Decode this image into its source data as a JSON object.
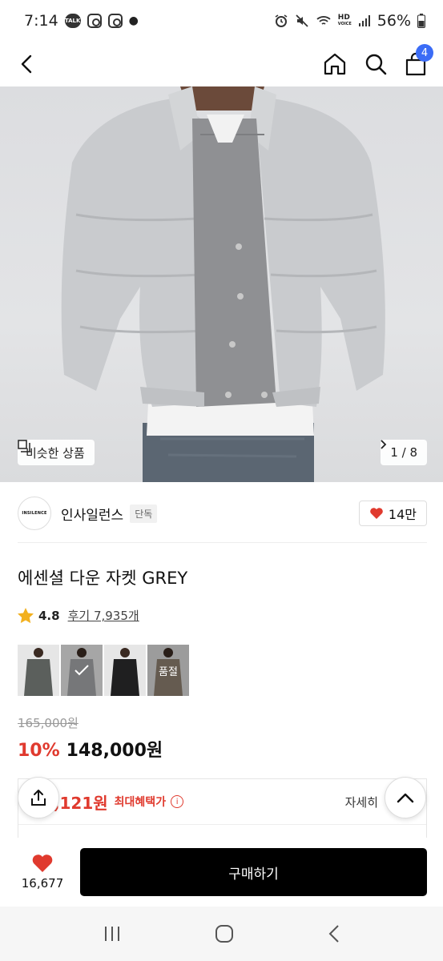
{
  "status": {
    "time": "7:14",
    "talk": "TALK",
    "hd": "HD",
    "voice": "VOICE",
    "battery": "56%"
  },
  "appbar": {
    "cart_count": "4"
  },
  "hero": {
    "similar_label": "비슷한 상품",
    "counter": "1 / 8"
  },
  "brand": {
    "logo_text": "INSILENCE",
    "name": "인사일런스",
    "tag": "단독",
    "likes": "14만"
  },
  "product": {
    "title": "에센셜 다운 자켓 GREY",
    "rating": "4.8",
    "reviews": "후기 7,935개",
    "variants": [
      {
        "color": "#5b5f5c",
        "soldout": ""
      },
      {
        "color": "#a4a6a8",
        "soldout": "",
        "selected": true
      },
      {
        "color": "#1f1f20",
        "soldout": ""
      },
      {
        "color": "#8c7f6f",
        "soldout": "품절"
      }
    ],
    "original_price": "165,000원",
    "discount": "10%",
    "price": "148,000원"
  },
  "benefit": {
    "price": "2,121원",
    "label": "최대혜택가",
    "more": "자세히"
  },
  "bottom": {
    "wish_count": "16,677",
    "buy_label": "구매하기"
  },
  "colors": {
    "accent_red": "#e03a2e",
    "badge_blue": "#3b6cf6"
  }
}
